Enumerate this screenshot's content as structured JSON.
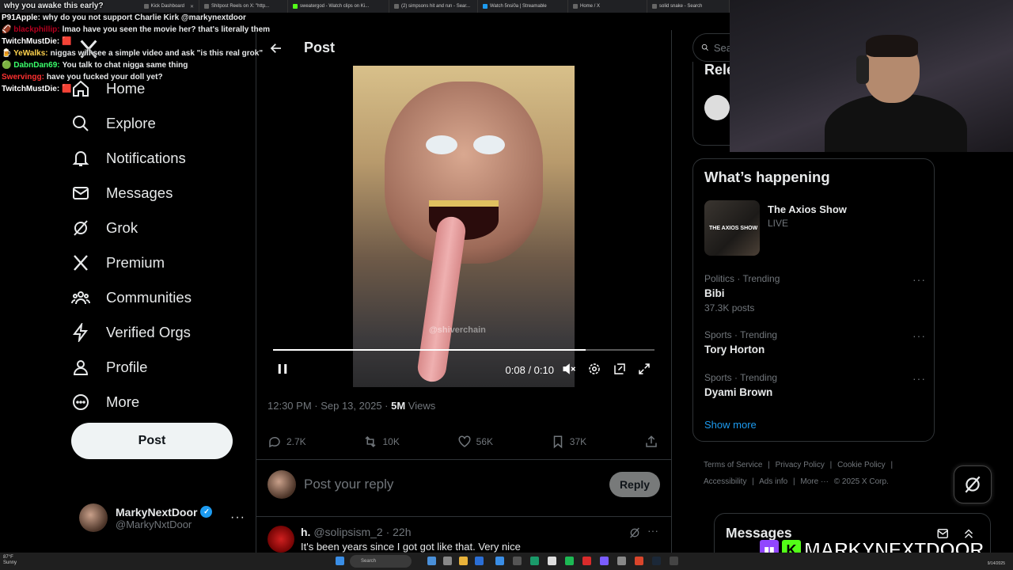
{
  "browser_tabs": [
    {
      "label": "Kick Dashboard"
    },
    {
      "label": "Shitpost Reels on X: \"http..."
    },
    {
      "label": "sweatergod - Watch clips on Ki..."
    },
    {
      "label": "(2) simpsons hit and run - Sear..."
    },
    {
      "label": "Watch 5nsi0a | Streamable"
    },
    {
      "label": "Home / X"
    },
    {
      "label": "solid snake - Search"
    }
  ],
  "chat": [
    {
      "user": "",
      "text": "why you awake this early?",
      "color": "#ff4d4d"
    },
    {
      "user": "P91Apple:",
      "text": "why do you not support Charlie Kirk @markynextdoor",
      "color": "#ffffff"
    },
    {
      "user": "blackphillip:",
      "text": "lmao have you seen the movie her? that's literally them",
      "color": "#b5001f"
    },
    {
      "user": "TwitchMustDie:",
      "text": "",
      "color": "#ffffff"
    },
    {
      "user": "YeWalks:",
      "text": "niggas will see a simple video and ask \"is this real grok\"",
      "color": "#ffd34d"
    },
    {
      "user": "DabnDan69:",
      "text": "You talk to chat nigga same thing",
      "color": "#3aff6b"
    },
    {
      "user": "Swervingg:",
      "text": "have you fucked your doll yet?",
      "color": "#ff3030"
    },
    {
      "user": "TwitchMustDie:",
      "text": "",
      "color": "#ffffff"
    }
  ],
  "nav": {
    "items": [
      {
        "label": "Home",
        "icon": "home-icon"
      },
      {
        "label": "Explore",
        "icon": "search-icon"
      },
      {
        "label": "Notifications",
        "icon": "bell-icon"
      },
      {
        "label": "Messages",
        "icon": "envelope-icon"
      },
      {
        "label": "Grok",
        "icon": "grok-icon"
      },
      {
        "label": "Premium",
        "icon": "x-logo-icon"
      },
      {
        "label": "Communities",
        "icon": "people-icon"
      },
      {
        "label": "Verified Orgs",
        "icon": "lightning-icon"
      },
      {
        "label": "Profile",
        "icon": "person-icon"
      },
      {
        "label": "More",
        "icon": "more-circle-icon"
      }
    ],
    "post_label": "Post"
  },
  "account": {
    "name": "MarkyNextDoor",
    "handle": "@MarkyNxtDoor"
  },
  "header": {
    "title": "Post"
  },
  "video": {
    "watermark": "@shiverchain",
    "time": "0:08 / 0:10",
    "progress": 0.82
  },
  "post_meta": {
    "time": "12:30 PM · Sep 13, 2025 · ",
    "views_count": "5M",
    "views_label": " Views"
  },
  "actions": {
    "replies": "2.7K",
    "reposts": "10K",
    "likes": "56K",
    "bookmarks": "37K"
  },
  "reply_box": {
    "placeholder": "Post your reply",
    "button": "Reply"
  },
  "reply_tweet": {
    "name": "h.",
    "handle": "@solipsism_2 · 22h",
    "text": "It's been years since I got got like that. Very nice"
  },
  "right": {
    "search_placeholder": "Sea",
    "relevant_title": "Rele",
    "happening_title": "What’s happening",
    "axios": {
      "name": "The Axios Show",
      "status": "LIVE",
      "thumb_text": "THE AXIOS SHOW"
    },
    "trends": [
      {
        "category": "Politics · Trending",
        "name": "Bibi",
        "count": "37.3K posts"
      },
      {
        "category": "Sports · Trending",
        "name": "Tory Horton",
        "count": ""
      },
      {
        "category": "Sports · Trending",
        "name": "Dyami Brown",
        "count": ""
      }
    ],
    "show_more": "Show more",
    "footer": [
      "Terms of Service",
      "|",
      "Privacy Policy",
      "|",
      "Cookie Policy",
      "|",
      "Accessibility",
      "|",
      "Ads info",
      "|",
      "More ···",
      "© 2025 X Corp."
    ],
    "messages_title": "Messages"
  },
  "brand": {
    "text": "MARKYNEXTDOOR",
    "k": "K"
  },
  "taskbar": {
    "temp": "87°F",
    "weather": "Sunny",
    "search": "Search",
    "date": "9/14/2025"
  },
  "colors": {
    "accent": "#1d9bf0",
    "background": "#000000",
    "muted": "#71767b",
    "kick_green": "#53fc18",
    "twitch_purple": "#9146ff"
  }
}
